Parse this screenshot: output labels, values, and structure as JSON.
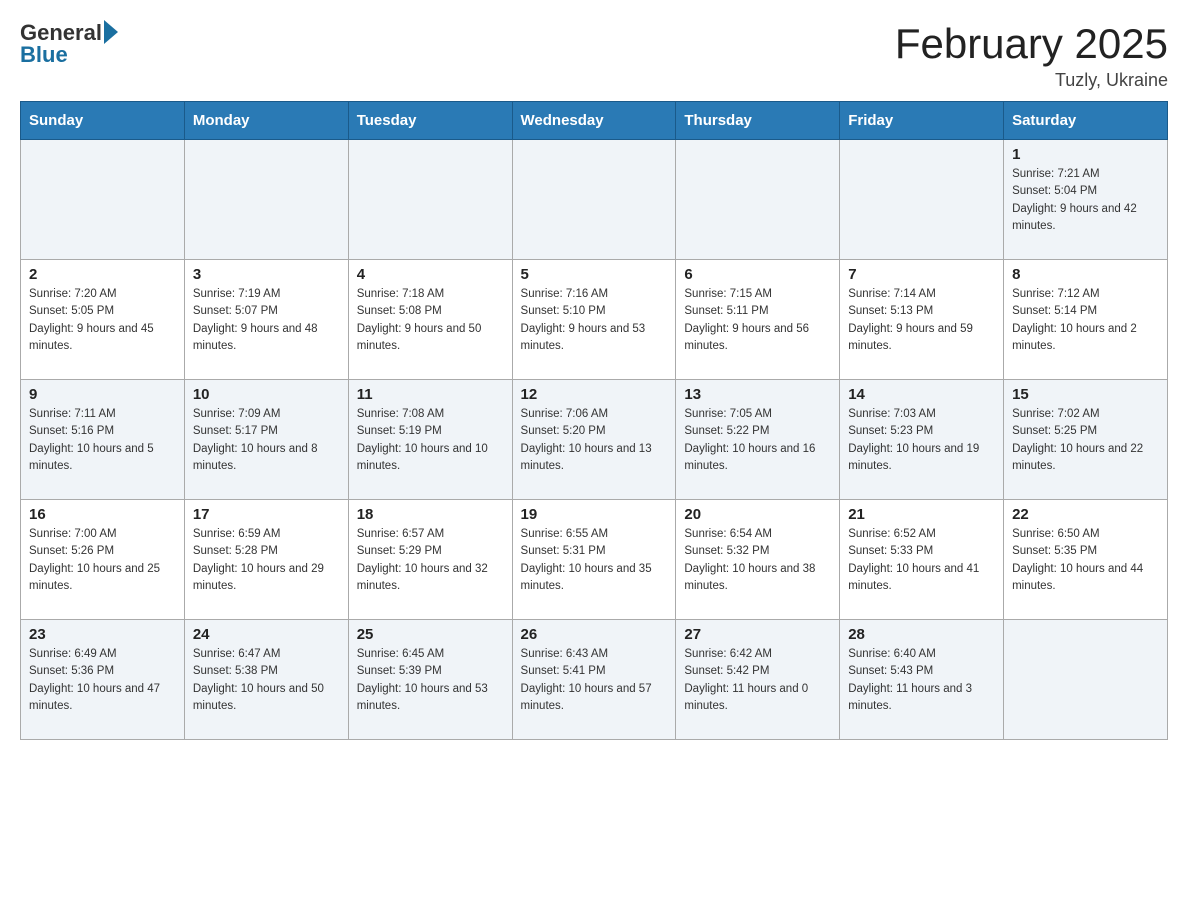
{
  "header": {
    "logo": {
      "text_general": "General",
      "text_blue": "Blue"
    },
    "title": "February 2025",
    "location": "Tuzly, Ukraine"
  },
  "days_of_week": [
    "Sunday",
    "Monday",
    "Tuesday",
    "Wednesday",
    "Thursday",
    "Friday",
    "Saturday"
  ],
  "weeks": [
    {
      "days": [
        {
          "num": "",
          "info": ""
        },
        {
          "num": "",
          "info": ""
        },
        {
          "num": "",
          "info": ""
        },
        {
          "num": "",
          "info": ""
        },
        {
          "num": "",
          "info": ""
        },
        {
          "num": "",
          "info": ""
        },
        {
          "num": "1",
          "info": "Sunrise: 7:21 AM\nSunset: 5:04 PM\nDaylight: 9 hours and 42 minutes."
        }
      ]
    },
    {
      "days": [
        {
          "num": "2",
          "info": "Sunrise: 7:20 AM\nSunset: 5:05 PM\nDaylight: 9 hours and 45 minutes."
        },
        {
          "num": "3",
          "info": "Sunrise: 7:19 AM\nSunset: 5:07 PM\nDaylight: 9 hours and 48 minutes."
        },
        {
          "num": "4",
          "info": "Sunrise: 7:18 AM\nSunset: 5:08 PM\nDaylight: 9 hours and 50 minutes."
        },
        {
          "num": "5",
          "info": "Sunrise: 7:16 AM\nSunset: 5:10 PM\nDaylight: 9 hours and 53 minutes."
        },
        {
          "num": "6",
          "info": "Sunrise: 7:15 AM\nSunset: 5:11 PM\nDaylight: 9 hours and 56 minutes."
        },
        {
          "num": "7",
          "info": "Sunrise: 7:14 AM\nSunset: 5:13 PM\nDaylight: 9 hours and 59 minutes."
        },
        {
          "num": "8",
          "info": "Sunrise: 7:12 AM\nSunset: 5:14 PM\nDaylight: 10 hours and 2 minutes."
        }
      ]
    },
    {
      "days": [
        {
          "num": "9",
          "info": "Sunrise: 7:11 AM\nSunset: 5:16 PM\nDaylight: 10 hours and 5 minutes."
        },
        {
          "num": "10",
          "info": "Sunrise: 7:09 AM\nSunset: 5:17 PM\nDaylight: 10 hours and 8 minutes."
        },
        {
          "num": "11",
          "info": "Sunrise: 7:08 AM\nSunset: 5:19 PM\nDaylight: 10 hours and 10 minutes."
        },
        {
          "num": "12",
          "info": "Sunrise: 7:06 AM\nSunset: 5:20 PM\nDaylight: 10 hours and 13 minutes."
        },
        {
          "num": "13",
          "info": "Sunrise: 7:05 AM\nSunset: 5:22 PM\nDaylight: 10 hours and 16 minutes."
        },
        {
          "num": "14",
          "info": "Sunrise: 7:03 AM\nSunset: 5:23 PM\nDaylight: 10 hours and 19 minutes."
        },
        {
          "num": "15",
          "info": "Sunrise: 7:02 AM\nSunset: 5:25 PM\nDaylight: 10 hours and 22 minutes."
        }
      ]
    },
    {
      "days": [
        {
          "num": "16",
          "info": "Sunrise: 7:00 AM\nSunset: 5:26 PM\nDaylight: 10 hours and 25 minutes."
        },
        {
          "num": "17",
          "info": "Sunrise: 6:59 AM\nSunset: 5:28 PM\nDaylight: 10 hours and 29 minutes."
        },
        {
          "num": "18",
          "info": "Sunrise: 6:57 AM\nSunset: 5:29 PM\nDaylight: 10 hours and 32 minutes."
        },
        {
          "num": "19",
          "info": "Sunrise: 6:55 AM\nSunset: 5:31 PM\nDaylight: 10 hours and 35 minutes."
        },
        {
          "num": "20",
          "info": "Sunrise: 6:54 AM\nSunset: 5:32 PM\nDaylight: 10 hours and 38 minutes."
        },
        {
          "num": "21",
          "info": "Sunrise: 6:52 AM\nSunset: 5:33 PM\nDaylight: 10 hours and 41 minutes."
        },
        {
          "num": "22",
          "info": "Sunrise: 6:50 AM\nSunset: 5:35 PM\nDaylight: 10 hours and 44 minutes."
        }
      ]
    },
    {
      "days": [
        {
          "num": "23",
          "info": "Sunrise: 6:49 AM\nSunset: 5:36 PM\nDaylight: 10 hours and 47 minutes."
        },
        {
          "num": "24",
          "info": "Sunrise: 6:47 AM\nSunset: 5:38 PM\nDaylight: 10 hours and 50 minutes."
        },
        {
          "num": "25",
          "info": "Sunrise: 6:45 AM\nSunset: 5:39 PM\nDaylight: 10 hours and 53 minutes."
        },
        {
          "num": "26",
          "info": "Sunrise: 6:43 AM\nSunset: 5:41 PM\nDaylight: 10 hours and 57 minutes."
        },
        {
          "num": "27",
          "info": "Sunrise: 6:42 AM\nSunset: 5:42 PM\nDaylight: 11 hours and 0 minutes."
        },
        {
          "num": "28",
          "info": "Sunrise: 6:40 AM\nSunset: 5:43 PM\nDaylight: 11 hours and 3 minutes."
        },
        {
          "num": "",
          "info": ""
        }
      ]
    }
  ]
}
